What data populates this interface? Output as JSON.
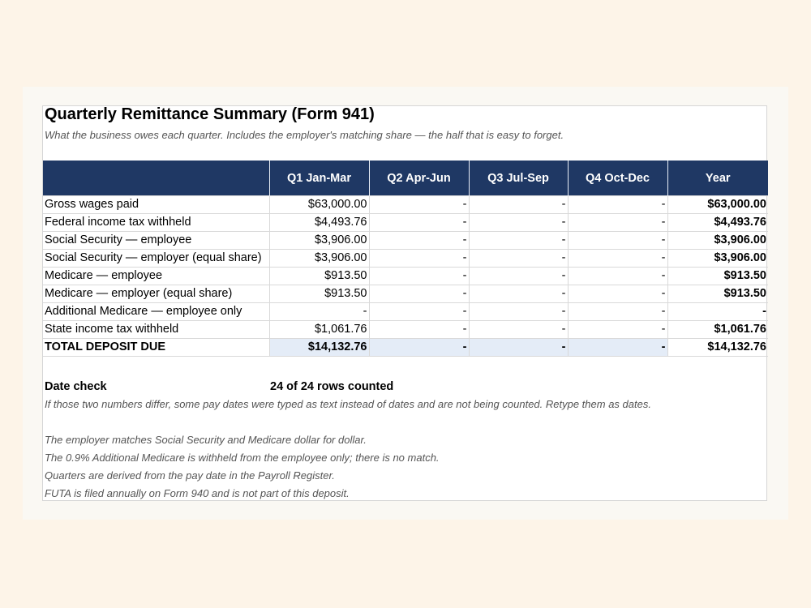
{
  "title": "Quarterly Remittance Summary (Form 941)",
  "subtitle": "What the business owes each quarter. Includes the employer's matching share — the half that is easy to forget.",
  "table": {
    "headers": [
      "",
      "Q1  Jan-Mar",
      "Q2  Apr-Jun",
      "Q3  Jul-Sep",
      "Q4  Oct-Dec",
      "Year"
    ],
    "rows": [
      {
        "label": "Gross wages paid",
        "values": [
          "$63,000.00",
          "-",
          "-",
          "-",
          "$63,000.00"
        ]
      },
      {
        "label": "Federal income tax withheld",
        "values": [
          "$4,493.76",
          "-",
          "-",
          "-",
          "$4,493.76"
        ]
      },
      {
        "label": "Social Security — employee",
        "values": [
          "$3,906.00",
          "-",
          "-",
          "-",
          "$3,906.00"
        ]
      },
      {
        "label": "Social Security — employer (equal share)",
        "values": [
          "$3,906.00",
          "-",
          "-",
          "-",
          "$3,906.00"
        ]
      },
      {
        "label": "Medicare — employee",
        "values": [
          "$913.50",
          "-",
          "-",
          "-",
          "$913.50"
        ]
      },
      {
        "label": "Medicare — employer (equal share)",
        "values": [
          "$913.50",
          "-",
          "-",
          "-",
          "$913.50"
        ]
      },
      {
        "label": "Additional Medicare — employee only",
        "values": [
          "-",
          "-",
          "-",
          "-",
          "-"
        ]
      },
      {
        "label": "State income tax withheld",
        "values": [
          "$1,061.76",
          "-",
          "-",
          "-",
          "$1,061.76"
        ]
      }
    ],
    "total": {
      "label": "TOTAL DEPOSIT DUE",
      "values": [
        "$14,132.76",
        "-",
        "-",
        "-",
        "$14,132.76"
      ]
    }
  },
  "date_check": {
    "label": "Date check",
    "value": "24 of 24 rows counted",
    "note": "If those two numbers differ, some pay dates were typed as text instead of dates and are not being counted. Retype them as dates."
  },
  "notes": [
    "The employer matches Social Security and Medicare dollar for dollar.",
    "The 0.9% Additional Medicare is withheld from the employee only; there is no match.",
    "Quarters are derived from the pay date in the Payroll Register.",
    "FUTA is filed annually on Form 940 and is not part of this deposit."
  ],
  "colors": {
    "header_bg": "#1f3864",
    "total_highlight": "#e4ecf7",
    "page_bg": "#fdf4e8"
  }
}
